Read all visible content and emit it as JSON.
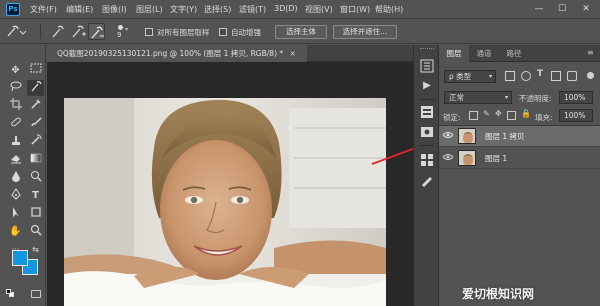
{
  "app": {
    "logo": "Ps"
  },
  "menu": [
    "文件(F)",
    "编辑(E)",
    "图像(I)",
    "图层(L)",
    "文字(Y)",
    "选择(S)",
    "滤镜(T)",
    "3D(D)",
    "视图(V)",
    "窗口(W)",
    "帮助(H)"
  ],
  "window_controls": {
    "minimize": "—",
    "maximize": "☐",
    "close": "✕"
  },
  "options": {
    "brush_size": "9",
    "sample_all_layers": "对所有图层取样",
    "auto_enhance": "自动增强",
    "select_subject": "选择主体",
    "select_and_mask": "选择并遮住..."
  },
  "document": {
    "tab_title": "QQ截图20190325130121.png @ 100% (图层 1 拷贝, RGB/8) *",
    "tab_close": "×"
  },
  "layers_panel": {
    "tabs": [
      "图层",
      "通道",
      "路径"
    ],
    "active_tab": 0,
    "filter_kind": "ρ 类型",
    "blend_mode": "正常",
    "opacity_label": "不透明度:",
    "opacity_value": "100%",
    "lock_label": "锁定:",
    "fill_label": "填充:",
    "fill_value": "100%",
    "layers": [
      {
        "name": "图层 1 拷贝",
        "visible": true,
        "selected": true
      },
      {
        "name": "图层 1",
        "visible": true,
        "selected": false
      }
    ]
  },
  "colors": {
    "foreground": "#1296e0",
    "background": "#1296e0",
    "annotation_arrow": "#e8262c"
  },
  "watermark": "爱切根知识网"
}
